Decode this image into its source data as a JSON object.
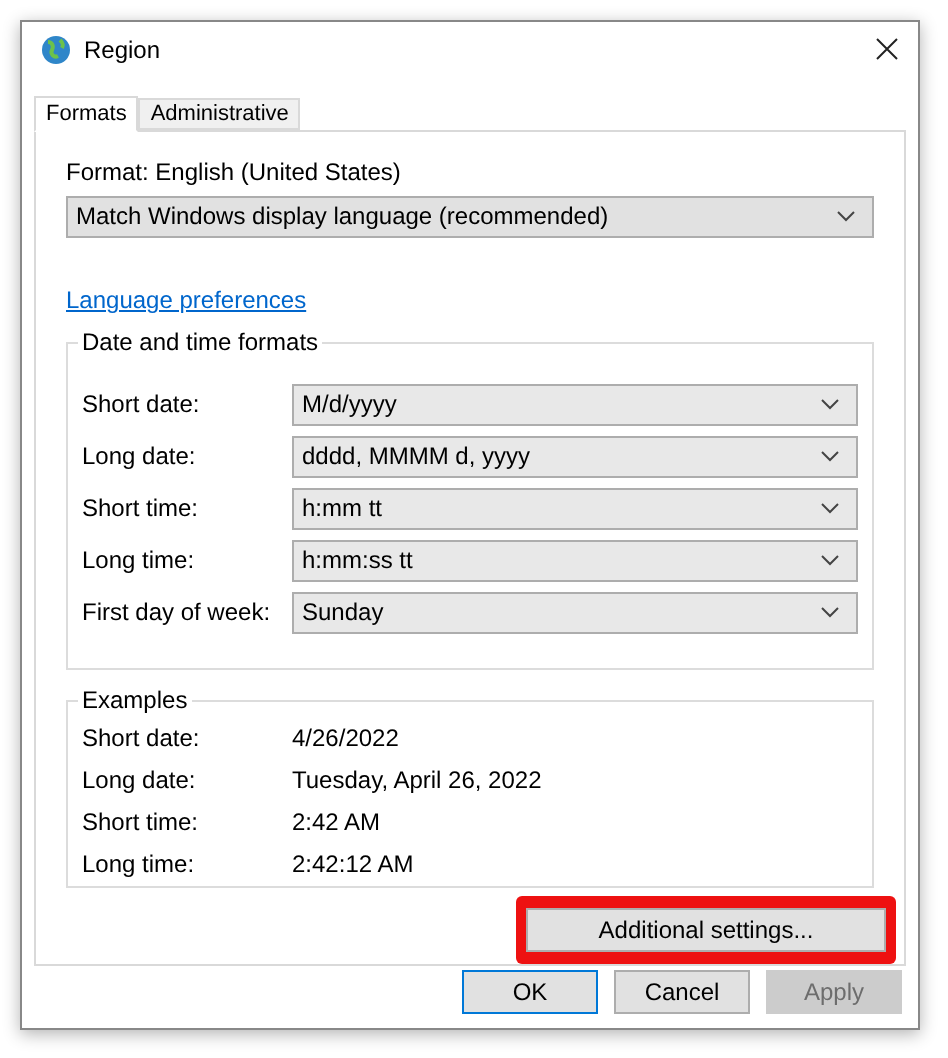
{
  "window": {
    "title": "Region"
  },
  "tabs": [
    {
      "label": "Formats",
      "selected": true
    },
    {
      "label": "Administrative",
      "selected": false
    }
  ],
  "format": {
    "label": "Format: English (United States)",
    "value": "Match Windows display language (recommended)"
  },
  "language_link": "Language preferences",
  "date_time_formats": {
    "title": "Date and time formats",
    "rows": [
      {
        "label": "Short date:",
        "value": "M/d/yyyy"
      },
      {
        "label": "Long date:",
        "value": "dddd, MMMM d, yyyy"
      },
      {
        "label": "Short time:",
        "value": "h:mm tt"
      },
      {
        "label": "Long time:",
        "value": "h:mm:ss tt"
      },
      {
        "label": "First day of week:",
        "value": "Sunday"
      }
    ]
  },
  "examples": {
    "title": "Examples",
    "rows": [
      {
        "label": "Short date:",
        "value": "4/26/2022"
      },
      {
        "label": "Long date:",
        "value": "Tuesday, April 26, 2022"
      },
      {
        "label": "Short time:",
        "value": "2:42 AM"
      },
      {
        "label": "Long time:",
        "value": "2:42:12 AM"
      }
    ]
  },
  "additional_settings": {
    "label": "Additional settings...",
    "highlighted": true
  },
  "buttons": [
    {
      "label": "OK",
      "disabled": false,
      "default": true
    },
    {
      "label": "Cancel",
      "disabled": false,
      "default": false
    },
    {
      "label": "Apply",
      "disabled": true,
      "default": false
    }
  ]
}
